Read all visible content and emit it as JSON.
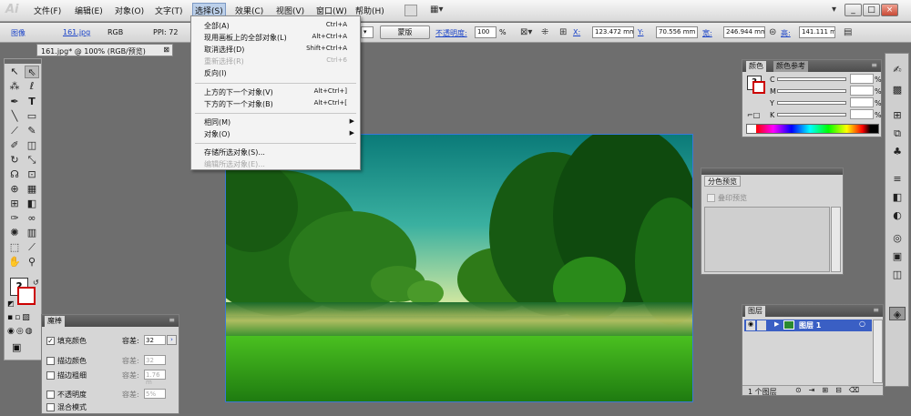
{
  "menubar": {
    "logo": "Ai",
    "items": [
      "文件(F)",
      "编辑(E)",
      "对象(O)",
      "文字(T)",
      "选择(S)",
      "效果(C)",
      "视图(V)",
      "窗口(W)",
      "帮助(H)"
    ],
    "window_buttons": [
      "_",
      "□",
      "×"
    ]
  },
  "control": {
    "label": "图像",
    "file": "161.jpg",
    "mode": "RGB",
    "ppi": "PPI: 72",
    "mask_button": "蒙版",
    "opacity_label": "不透明度:",
    "opacity_value": "100",
    "opacity_unit": "%",
    "x_label": "X:",
    "x_value": "123.472 mm",
    "y_label": "Y:",
    "y_value": "70.556 mm",
    "w_label": "宽:",
    "w_value": "246.944 mm",
    "h_label": "高:",
    "h_value": "141.111 mm"
  },
  "document_tab": "161.jpg* @ 100% (RGB/预览)",
  "select_menu": {
    "items": [
      {
        "label": "全部(A)",
        "shortcut": "Ctrl+A",
        "disabled": false
      },
      {
        "label": "现用画板上的全部对象(L)",
        "shortcut": "Alt+Ctrl+A",
        "disabled": false
      },
      {
        "label": "取消选择(D)",
        "shortcut": "Shift+Ctrl+A",
        "disabled": false
      },
      {
        "label": "重新选择(R)",
        "shortcut": "Ctrl+6",
        "disabled": true
      },
      {
        "label": "反向(I)",
        "shortcut": "",
        "disabled": false
      },
      {
        "label": "上方的下一个对象(V)",
        "shortcut": "Alt+Ctrl+]",
        "disabled": false
      },
      {
        "label": "下方的下一个对象(B)",
        "shortcut": "Alt+Ctrl+[",
        "disabled": false
      },
      {
        "label": "相同(M)",
        "shortcut": "",
        "disabled": false
      },
      {
        "label": "对象(O)",
        "shortcut": "",
        "disabled": false
      },
      {
        "label": "存储所选对象(S)...",
        "shortcut": "",
        "disabled": false
      },
      {
        "label": "编辑所选对象(E)...",
        "shortcut": "",
        "disabled": true
      }
    ]
  },
  "magic_wand": {
    "title": "魔棒",
    "fill_color": "填充颜色",
    "stroke_color": "描边颜色",
    "stroke_weight": "描边粗细",
    "opacity": "不透明度",
    "blend_mode": "混合模式",
    "tolerance": "容差:",
    "fill_tolerance": "32",
    "stroke_tolerance": "32",
    "weight_tolerance": "1.76 m",
    "opacity_tolerance": "5%"
  },
  "color_panel": {
    "tab_color": "颜色",
    "tab_guide": "颜色参考",
    "channels": [
      "C",
      "M",
      "Y",
      "K"
    ],
    "unit": "%"
  },
  "separations": {
    "title": "分色预览",
    "overprint": "叠印预览"
  },
  "layers": {
    "title": "图层",
    "layer_name": "图层 1",
    "count": "1 个图层"
  },
  "colors": {
    "accent": "#1a43c8",
    "layer_highlight": "#3a5fc4",
    "panel_bg": "#d6d6d6",
    "workspace": "#6e6e6e"
  }
}
